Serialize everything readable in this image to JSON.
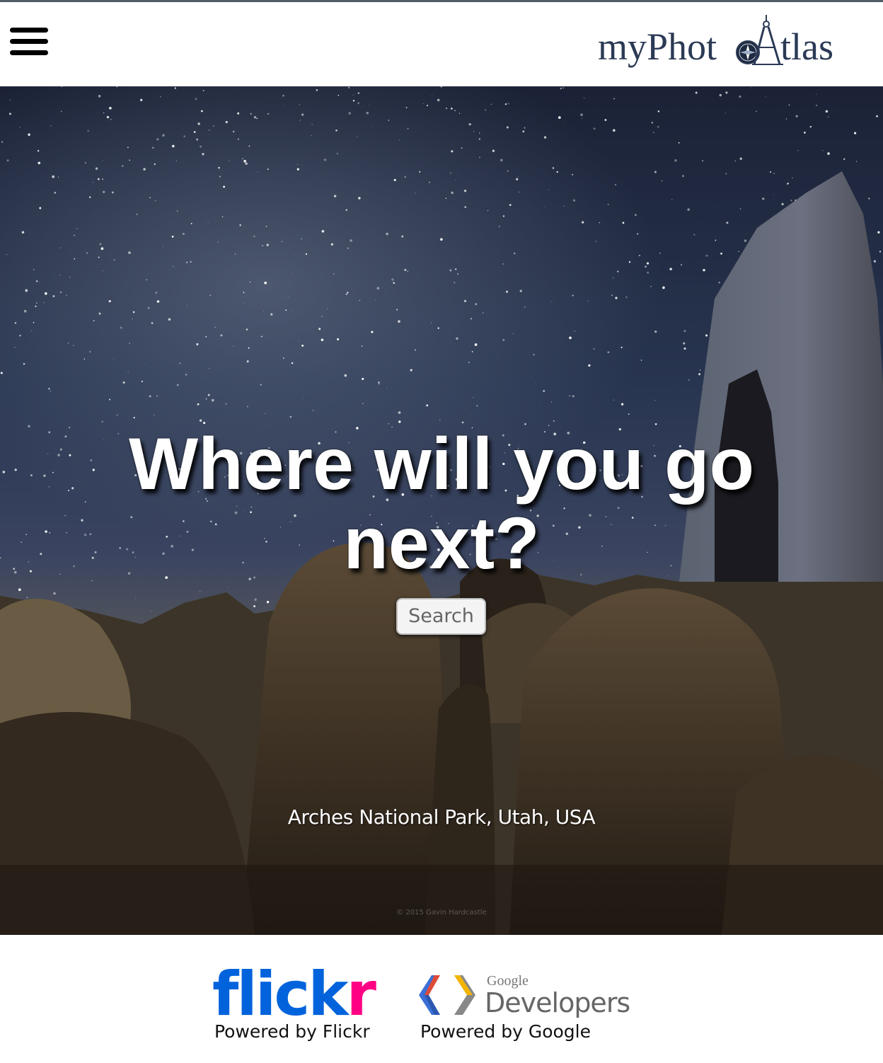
{
  "header": {
    "logo_prefix": "myPhot",
    "logo_suffix": "tlas"
  },
  "hero": {
    "title": "Where will you go next?",
    "search_label": "Search",
    "location": "Arches National Park, Utah, USA",
    "copyright": "© 2015 Gavin Hardcastle"
  },
  "footer": {
    "flickr_logo_a": "flick",
    "flickr_logo_b": "r",
    "flickr_caption": "Powered by Flickr",
    "google_small": "Google",
    "google_developers": "Developers",
    "google_caption": "Powered by Google"
  },
  "colors": {
    "logo_navy": "#2b3a55",
    "flickr_blue": "#0063dc",
    "flickr_pink": "#ff0084"
  },
  "icons": {
    "menu": "hamburger-icon",
    "logo_mark": "compass-icon"
  }
}
